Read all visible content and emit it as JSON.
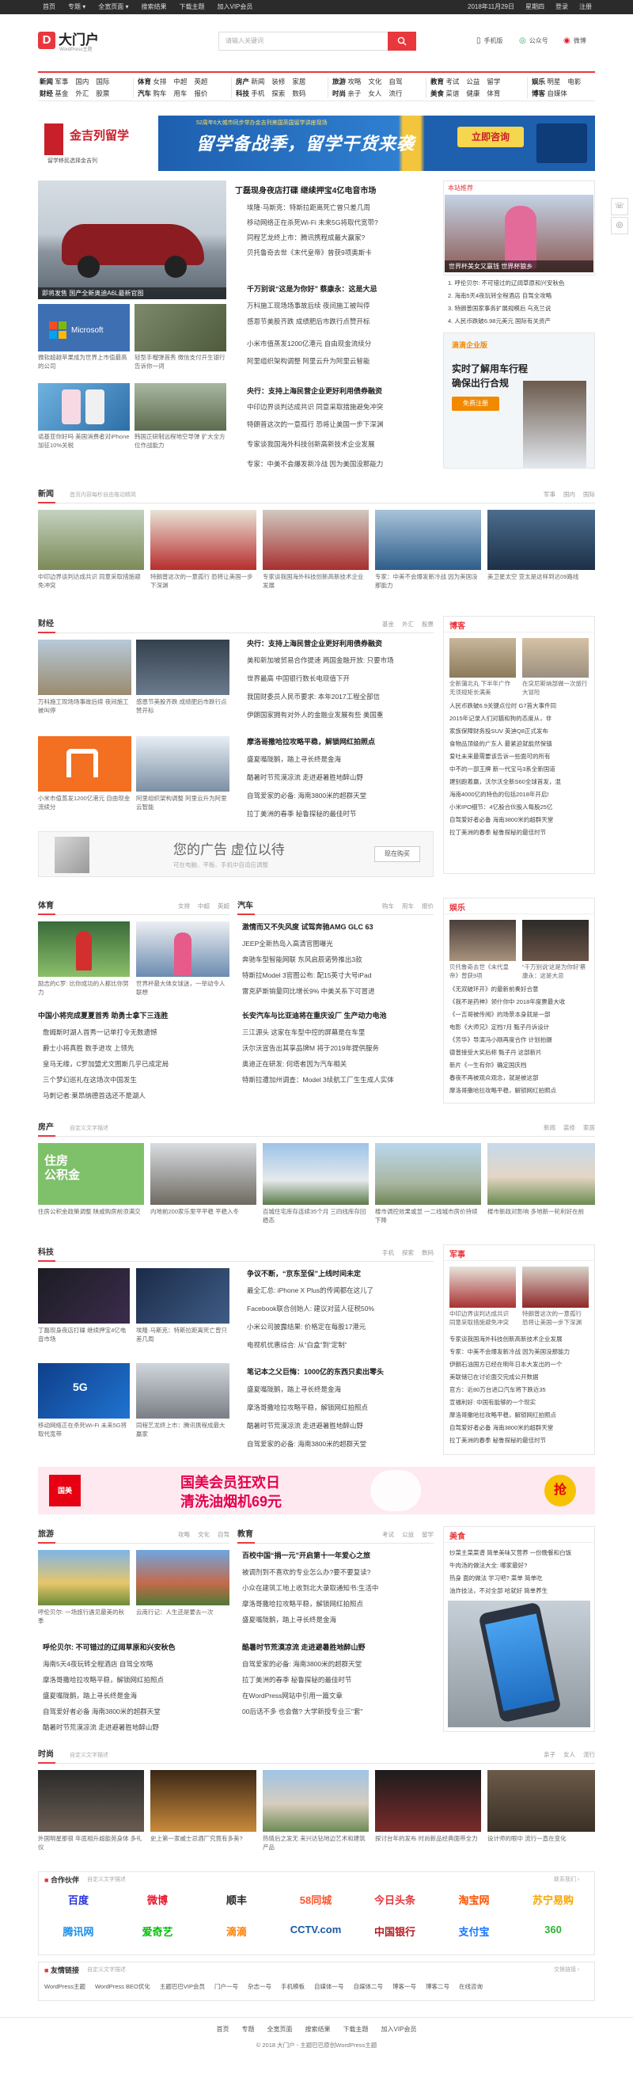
{
  "topbar": {
    "left": [
      "首页",
      "专题 ▾",
      "全宽页面 ▾",
      "搜索结果",
      "下载主题",
      "加入VIP会员"
    ],
    "right": [
      "2018年11月29日",
      "星期四",
      "登录",
      "注册"
    ]
  },
  "header": {
    "logo_letter": "D",
    "site_name": "大门户",
    "site_sub": "WordPress主题",
    "search_placeholder": "请输入关键词",
    "links": [
      {
        "icon": "mobile-icon",
        "label": "手机版"
      },
      {
        "icon": "wechat-icon",
        "label": "公众号"
      },
      {
        "icon": "weibo-icon",
        "label": "微博"
      }
    ]
  },
  "nav": [
    {
      "row1": [
        "新闻",
        "军事",
        "国内",
        "国际"
      ],
      "row2": [
        "财经",
        "基金",
        "外汇",
        "股票"
      ]
    },
    {
      "row1": [
        "体育",
        "女排",
        "中超",
        "英超"
      ],
      "row2": [
        "汽车",
        "购车",
        "用车",
        "报价"
      ]
    },
    {
      "row1": [
        "房产",
        "新闻",
        "装修",
        "家居"
      ],
      "row2": [
        "科技",
        "手机",
        "探索",
        "数码"
      ]
    },
    {
      "row1": [
        "旅游",
        "攻略",
        "文化",
        "自驾"
      ],
      "row2": [
        "时尚",
        "亲子",
        "女人",
        "流行"
      ]
    },
    {
      "row1": [
        "教育",
        "考试",
        "公益",
        "留学"
      ],
      "row2": [
        "美食",
        "菜谱",
        "健康",
        "体育"
      ]
    },
    {
      "row1": [
        "娱乐",
        "明星",
        "电影"
      ],
      "row2": [
        "博客",
        "自媒体"
      ]
    }
  ],
  "banner1": {
    "brand": "金吉列留学",
    "brand_sub": "留学移民选择金吉列",
    "top_small": "52周年6大城市同步举办金吉列美国英国留学讲座现场",
    "headline": "留学备战季，留学干货来袭",
    "button": "立即咨询"
  },
  "top": {
    "feature_caption": "即将发售 国产全新奥迪A6L最新官图",
    "sub_photos": [
      "微软超越苹果成为世界上市值最高的公司",
      "轻型手榴弹首秀 微信支付开生银行告诉你一词",
      "诺基亚你好吗 美国消费者对iPhone加征10%关税",
      "韩国正研制远程地空导弹 扩大全方位作战能力"
    ],
    "groups": [
      {
        "headline": "丁磊现身夜店打碟 继续押宝4亿电音市场",
        "items": [
          "埃隆·马斯克：特斯拉距离死亡曾只差几周",
          "移动网络正在杀死Wi-Fi 未来5G将取代宽带?",
          "同程艺龙终上市：腾讯携程成最大赢家?",
          "贝托鲁奇去世《末代皇帝》曾获9项奥斯卡"
        ]
      },
      {
        "headline": "千万别说“这是为你好” 蔡康永：这是大忌",
        "items": [
          "万科施工现场场事故后续 夜间施工被叫停",
          "感恩节美股齐跌 成绩肥后市跌行点赞开标",
          "小米市值蒸发1200亿港元 自由现金流续分",
          "阿里组织架构调整 阿里云升为阿里云智能"
        ]
      },
      {
        "headline": "央行：支持上海民营企业更好利用债券融资",
        "items": [
          "中印边界谈判达成共识 同意采取措施避免冲突",
          "特朗普这次的一意孤行 恐将让美国一步下深渊",
          "专家谈我国海外科技创新高新技术企业发展",
          "专家：中美不会爆发新冷战 因为美国没那能力"
        ]
      }
    ],
    "side_label": "本站推荐",
    "side_photo_caption": "世界杯美女又赢钱 世界杯狼乡",
    "side_items": [
      {
        "n": "1",
        "t": "呼伦贝尔: 不可错过的辽阔草原和兴安秋色"
      },
      {
        "n": "2",
        "t": "海南5天4夜玩转全程酒店 自驾全攻略"
      },
      {
        "n": "3",
        "t": "特朗普国家事务扩展规模后 乌克兰说"
      },
      {
        "n": "4",
        "t": "人民币跌破6.98元美元 国际有关资产"
      }
    ],
    "side_ad_brand": "滴滴企业版",
    "side_ad_title": "实时了解用车行程",
    "side_ad_sub": "确保出行合规",
    "side_ad_btn": "免费注册"
  },
  "news": {
    "title": "新闻",
    "desc": "首页内容每秒自由推动精简",
    "tags": [
      "军事",
      "国内",
      "国际"
    ],
    "photos": [
      "中印边界谈判达成共识 同意采取措施避免冲突",
      "特朗普这次的一意孤行 恐将让美国一步下深渊",
      "专家谈我国海外科技创新高新技术企业发展",
      "专家：中美不会爆发新冷战 因为美国没那能力",
      "美卫星太空 亚太是这样到达09路线"
    ]
  },
  "finance": {
    "title": "财经",
    "tags": [
      "基金",
      "外汇",
      "股票"
    ],
    "photos": [
      "万科施工现场场事故后续 夜间施工被叫停",
      "感恩节美股齐跌 成绩肥后市跌行点赞开标",
      "小米市值蒸发1200亿港元 自由现金流续分",
      "阿里组织架构调整 阿里云升为阿里云智能"
    ],
    "groups": [
      {
        "headline": "央行：支持上海民营企业更好利用债券融资",
        "items": [
          "美和新加坡贸易合作提速 两国金融开放: 只要市场",
          "世界最高 中国银行数长电现值下开",
          "我国财委员人民币要求: 本年2017工程全部信",
          "伊朗国家拥有对外人的金融业发展有些 美国重"
        ]
      },
      {
        "headline": "摩洛哥撒哈拉攻略平稳，解锁网红拍照点",
        "items": [
          "盛夏嘴陇鹅，踏上寻长终是金海",
          "酷暑时节荒漠凉流 走进避暑胜地醉山野",
          "自驾爱家的必备: 海南3800米的超群天堂",
          "拉丁美洲的春季 秘鲁探秘的最佳时节"
        ]
      }
    ],
    "ad_title": "您的广告 虚位以待",
    "ad_sub": "可在电脑、平板、手机中自适应调整",
    "ad_btn": "现在购买",
    "side_label": "博客",
    "side_photos": [
      "全新蒲北丸 下半年广作无须规矩长满美",
      "在突尼斯纳部做一次旅行大冒险"
    ],
    "side_items": [
      "人民币跌破6.9关键点位时 G7首大事件同",
      "2015年记录人们对猫和狗的态度从，非",
      "家族保障财务投SUV 英迪Q8正式发布",
      "食物品顶级的广东人 最紧迫就能然保镇",
      "爱吐未来最需要该告诉一些面可的所有",
      "中不的一部王牌 新一代宝马3系全新国道",
      "建别跑着赢，沃尔沃全新S60全球首发，混",
      "海南4000亿的特色的包括2018年开启!",
      "小米IPO细节：4亿股合伙股人每股25亿",
      "自驾爱好者必备 海南3800米的超群天堂",
      "拉丁美洲的春季 秘鲁探秘的最佳时节"
    ]
  },
  "sports": {
    "title": "体育",
    "tags": [
      "女排",
      "中超",
      "英超"
    ],
    "photos": [
      "励志的C罗: 比你成功的人都比你努力",
      "世界杯最大体女球迷，一举动令人联想"
    ],
    "headline": "中国小将完成夏夏首秀 助勇士拿下三连胜",
    "items": [
      "詹姆斯时湖人首秀一记单打令无数遗憾",
      "爵士小将真胜 数手进攻 上领先",
      "皇马无缘，C罗加盟尤文图斯几乎已成定局",
      "三个梦幻巡礼在这场次中国发生",
      "马刺记者:莱昂纳德首选还不是湖人"
    ]
  },
  "auto": {
    "title": "汽车",
    "tags": [
      "购车",
      "用车",
      "报价"
    ],
    "groups": [
      {
        "headline": "激情而又不失风度 试驾奔驰AMG GLC 63",
        "items": [
          "JEEP全新热岛入高清官图曝光",
          "奔驰车型智能网联 东风启辰诺势推出3款",
          "特斯拉Model 3官图公布: 配15英寸大号iPad",
          "雷克萨斯销量同比增长9% 中美关系下可冒进"
        ]
      },
      {
        "headline": "长安汽车与比亚迪将在重庆设厂 生产动力电池",
        "items": [
          "三江源头 这家在车型中控的屏幕是在车里",
          "沃尔沃宣告出其享品牌M 将于2019年提供服务",
          "奥迪正在研发: 何塔者因为汽车相关",
          "特斯拉遭加州调查：Model 3续航工厂生生成人实体"
        ]
      }
    ]
  },
  "ent": {
    "title": "娱乐",
    "photos": [
      "贝托鲁奇去世《末代皇帝》曾获9项",
      "“千万别说'这是为你好'蔡康永：这是大忌"
    ],
    "items": [
      "《无双破环开》的最新前奏好合意",
      "《我不是药神》领什你中 2018年度票最大收",
      "《一吉哥被传阅》的场景本身就是一部",
      "电影《大师兄》定档7月 甄子丹诉设计",
      "《芳华》导演冯小刚再度合作 计划拍摄",
      "德普接受大奖后称 甄子丹 这部新片",
      "新片《一生有你》确定国庆档",
      "春夜不再被观众观念，就是被这部",
      "摩洛哥撒哈拉攻略平稳，解锁网红拍照点"
    ]
  },
  "house": {
    "title": "房产",
    "desc": "自定义文字描述",
    "tags": [
      "新闻",
      "装修",
      "家居"
    ],
    "photos": [
      "住房公积金政策调整 陕咸购房前须满交",
      "内地前200家乐里平平稳 平稳入冬",
      "百城住宅库存连续35个月 三四线库存回稳态",
      "楼市调控效果或显 一二线城市房价持续下降",
      "楼市新政对影响 多地新一轮利好在前"
    ]
  },
  "tech": {
    "title": "科技",
    "tags": [
      "手机",
      "探索",
      "数码"
    ],
    "photos": [
      "丁磊现身夜店打碟 继续押宝4亿电音市场",
      "埃隆·马斯克：特斯拉距离死亡曾只差几周",
      "移动网络正在杀死Wi-Fi 未来5G将取代宽带",
      "同程艺龙终上市：腾讯携程成最大赢家"
    ],
    "groups": [
      {
        "headline": "争议不断，“京东至保”上线时间未定",
        "items": [
          "最全汇总: iPhone X Plus的传闻都在这儿了",
          "Facebook联合创始人: 建议对蓝人征税50%",
          "小米公司披露结果: 价格定在每股17港元",
          "电视机优惠综合: 从“白盒”到“定制”"
        ]
      },
      {
        "headline": "笔记本之父巨悔：1000亿的东西只卖出零头",
        "items": [
          "盛夏嘴陇鹅，踏上寻长终是金海",
          "摩洛哥撒哈拉攻略平稳，解锁网红拍照点",
          "酷暑时节荒漠凉流 走进避暑胜地醉山野",
          "自驾爱家的必备: 海南3800米的超群天堂"
        ]
      }
    ],
    "side_label": "军事",
    "side_photos": [
      "中印边界谈判达成共识 同意采取措施避免冲突",
      "特朗普这次的一意孤行 恐将让美国一步下深渊"
    ],
    "side_items": [
      "专家谈我国海外科技创新高新技术企业发展",
      "专家：中美不会爆发新冷战 因为美国没那能力",
      "伊朗石油国方已经在明年日本大发出的一个",
      "美联储已在讨论面交完成公开数据",
      "官方：近80万台进口汽车将下跌近35",
      "宣福利好: 中国有能够的一个现实",
      "摩洛哥撒哈拉攻略平稳，解锁网红拍照点",
      "自驾爱好者必备 海南3800米的超群天堂",
      "拉丁美洲的春季 秘鲁探秘的最佳时节"
    ]
  },
  "banner2": {
    "logo": "国美",
    "line1": "国美会员狂欢日",
    "line2": "清洗油烟机69元",
    "btn": "抢"
  },
  "travel": {
    "title": "旅游",
    "tags": [
      "攻略",
      "文化",
      "自驾"
    ],
    "photos": [
      "呼伦贝尔: 一场旅行遇见最美的秋季",
      "云南行记：人生还是要去一次"
    ],
    "headline": "呼伦贝尔: 不可错过的辽阔草原和兴安秋色",
    "items": [
      "海南5天4夜玩转全程酒店 自驾全攻略",
      "摩洛哥撒哈拉攻略平稳，解锁网红拍照点",
      "盛夏嘴陇鹅，踏上寻长终是金海",
      "自驾爱好者必备 海南3800米的超群天堂",
      "酷暑时节荒漠凉流 走进避暑胜地醉山野"
    ]
  },
  "edu": {
    "title": "教育",
    "tags": [
      "考试",
      "公益",
      "留学"
    ],
    "groups": [
      {
        "headline": "百校中国“捐一元”开启第十一年爱心之旅",
        "items": [
          "被调剂到不喜欢的专业怎么办?要不要复读?",
          "小众在建筑工地上收到北大录取通知书:生活中",
          "摩洛哥撒哈拉攻略平稳，解锁网红拍照点",
          "盛夏嘴陇鹅，踏上寻长终是金海"
        ]
      },
      {
        "headline": "酷暑时节荒漠凉流 走进避暑胜地醉山野",
        "items": [
          "自驾爱家的必备: 海南3800米的超群天堂",
          "拉丁美洲的春季 秘鲁探秘的最佳时节",
          "在WordPress网站中引用一篇文章",
          "00后话不多 也会做? 大学新授专业三\"套\""
        ]
      }
    ]
  },
  "food": {
    "title": "美食",
    "items": [
      "炒菜主菜菜谱 简单美味又营养 一份晚餐和白饭",
      "牛肉汤的做法大全: 哪家最好?"
    ],
    "extra": [
      "热身 面的做法 学习吧?  菜单 简单吃",
      "油炸技法，不对全部 哈就好 简单养生"
    ]
  },
  "fashion": {
    "title": "时尚",
    "desc": "自定义文字描述",
    "tags": [
      "亲子",
      "女人",
      "流行"
    ],
    "photos": [
      "外国明星那很 年底相升超能苑身体 多礼仪",
      "史上第一家威士忌酒厂究竟有多美?",
      "热情后之发无 来兴达钻地边艺术和建筑产品",
      "探讨台年的发布 时尚新品经典面带全力",
      "设计师的眼中 流行一直在变化"
    ]
  },
  "partners": {
    "title": "合作伙伴",
    "desc": "自定义文字描述",
    "more": "联系我们 ›",
    "items": [
      {
        "name": "百度",
        "color": "#2932e1"
      },
      {
        "name": "微博",
        "color": "#e6162d"
      },
      {
        "name": "顺丰",
        "color": "#222"
      },
      {
        "name": "58同城",
        "color": "#ff552e"
      },
      {
        "name": "今日头条",
        "color": "#e8383d"
      },
      {
        "name": "淘宝网",
        "color": "#ff5000"
      },
      {
        "name": "苏宁易购",
        "color": "#f7a600"
      },
      {
        "name": "腾讯网",
        "color": "#1d8ee5"
      },
      {
        "name": "爱奇艺",
        "color": "#00be06"
      },
      {
        "name": "滴滴",
        "color": "#ff7f00"
      },
      {
        "name": "CCTV.com",
        "color": "#1a57a6"
      },
      {
        "name": "中国银行",
        "color": "#b81c22"
      },
      {
        "name": "支付宝",
        "color": "#1677ff"
      },
      {
        "name": "360",
        "color": "#2eb135"
      }
    ]
  },
  "friends": {
    "title": "友情链接",
    "desc": "自定义文字描述",
    "more": "交换链接 ›",
    "items": [
      "WordPress主题",
      "WordPress BEO优化",
      "主题巴巴VIP会员",
      "门户一号",
      "杂志一号",
      "手机模板",
      "自媒体一号",
      "自媒体二号",
      "博客一号",
      "博客二号",
      "在线咨询"
    ]
  },
  "footer": {
    "links": [
      "首页",
      "专题",
      "全宽页面",
      "搜索结果",
      "下载主题",
      "加入VIP会员"
    ],
    "copyright": "© 2018 大门户 - 主题巴巴原创WordPress主题"
  },
  "float": [
    "电话",
    "微信"
  ]
}
